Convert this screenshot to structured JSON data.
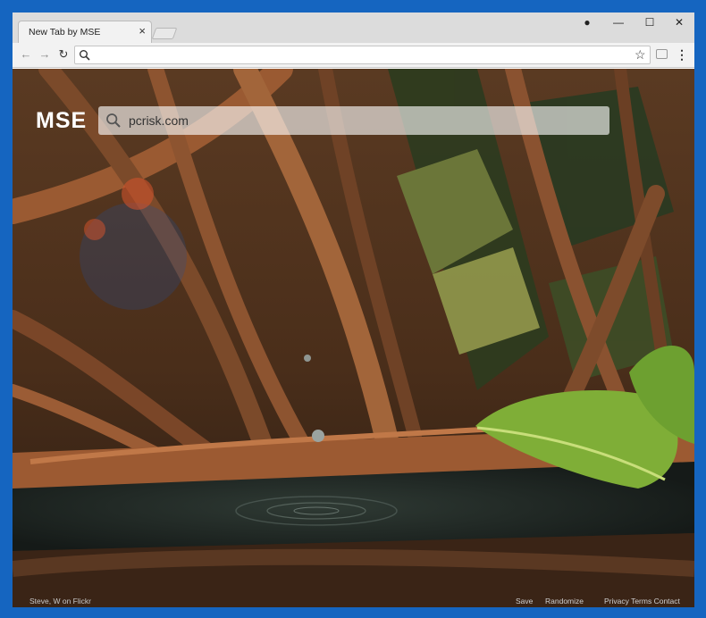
{
  "browser": {
    "tab_title": "New Tab by MSE",
    "tab_close": "×",
    "window_buttons": {
      "profile": "●",
      "minimize": "—",
      "maximize": "☐",
      "close": "✕"
    },
    "nav": {
      "back": "←",
      "forward": "→",
      "reload": "↻",
      "star": "☆",
      "menu": "⋮"
    },
    "address_value": ""
  },
  "page": {
    "brand": "MSE",
    "search_value": "pcrisk.com",
    "credit": "Steve, W on Flickr",
    "save": "Save",
    "randomize": "Randomize",
    "footer_links": "Privacy Terms Contact"
  },
  "colors": {
    "frame": "#1565c0",
    "titlebar": "#dcdcdc",
    "toolbar": "#f2f2f2"
  },
  "icons": {
    "search": "search-icon",
    "back": "arrow-left-icon",
    "forward": "arrow-right-icon",
    "reload": "reload-icon",
    "star": "star-icon",
    "menu": "kebab-menu-icon",
    "profile": "profile-icon",
    "extension": "extension-icon"
  }
}
